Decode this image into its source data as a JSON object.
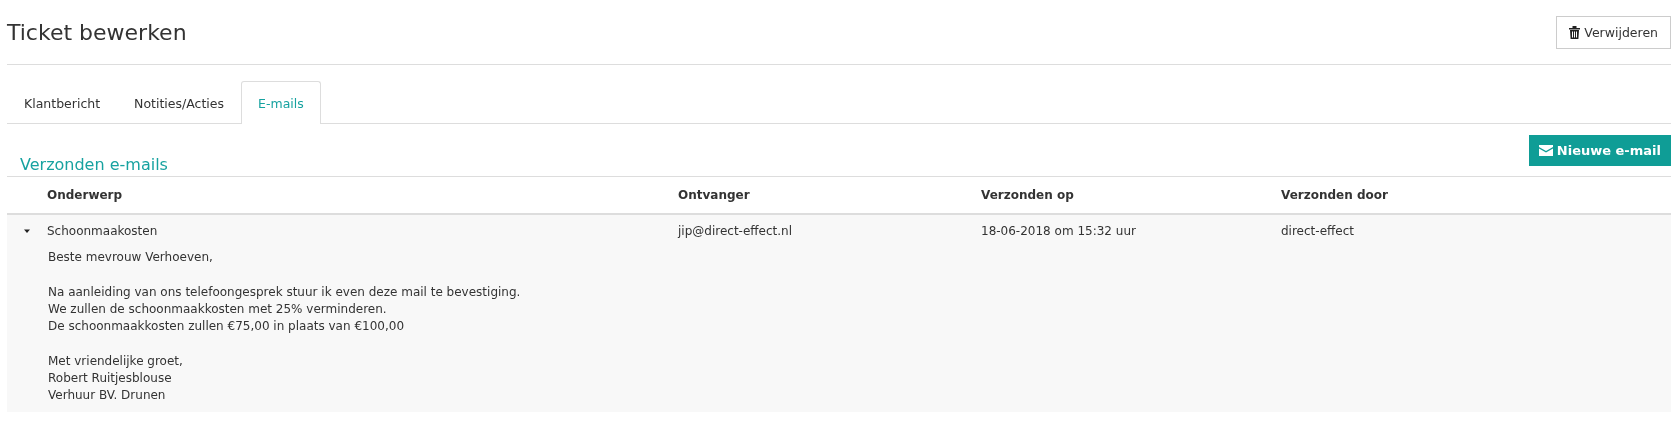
{
  "page": {
    "title": "Ticket bewerken",
    "delete_button": "Verwijderen"
  },
  "tabs": [
    {
      "label": "Klantbericht",
      "selected": false
    },
    {
      "label": "Notities/Acties",
      "selected": false
    },
    {
      "label": "E-mails",
      "selected": true
    }
  ],
  "section": {
    "title": "Verzonden e-mails",
    "new_button": "Nieuwe e-mail"
  },
  "table": {
    "columns": [
      "Onderwerp",
      "Ontvanger",
      "Verzonden op",
      "Verzonden door"
    ],
    "rows": [
      {
        "expanded": true,
        "cells": [
          "Schoonmaakosten",
          "jip@direct-effect.nl",
          "18-06-2018 om 15:32 uur",
          "direct-effect"
        ],
        "body": [
          [
            "Beste mevrouw Verhoeven,"
          ],
          [
            "Na aanleiding van ons telefoongesprek stuur ik even deze mail te bevestiging.",
            "We zullen de schoonmaakkosten met 25% verminderen.",
            "De schoonmaakkosten zullen €75,00 in plaats van €100,00"
          ],
          [
            "Met vriendelijke groet,",
            "Robert Ruitjesblouse",
            "Verhuur BV. Drunen"
          ]
        ]
      }
    ]
  }
}
